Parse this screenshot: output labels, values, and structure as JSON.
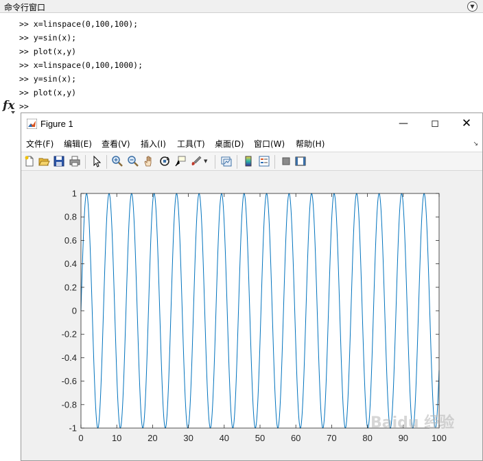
{
  "command_window": {
    "title": "命令行窗口",
    "prompt": ">>",
    "lines": [
      ">> x=linspace(0,100,100);",
      ">> y=sin(x);",
      ">> plot(x,y)",
      ">> x=linspace(0,100,1000);",
      ">> y=sin(x);",
      ">> plot(x,y)"
    ],
    "fx_label": "fx"
  },
  "figure": {
    "title": "Figure 1",
    "menus": [
      "文件(F)",
      "编辑(E)",
      "查看(V)",
      "插入(I)",
      "工具(T)",
      "桌面(D)",
      "窗口(W)",
      "帮助(H)"
    ],
    "toolbar_icons": [
      "new-figure-icon",
      "open-file-icon",
      "save-icon",
      "print-icon",
      "pointer-icon",
      "zoom-in-icon",
      "zoom-out-icon",
      "pan-icon",
      "rotate-3d-icon",
      "data-cursor-icon",
      "brush-icon",
      "link-plot-icon",
      "colorbar-icon",
      "legend-icon",
      "hide-plot-tools-icon",
      "show-plot-tools-icon"
    ]
  },
  "chart_data": {
    "type": "line",
    "function": "y = sin(x)",
    "x_range": [
      0,
      100
    ],
    "samples": 1000,
    "xlim": [
      0,
      100
    ],
    "ylim": [
      -1,
      1
    ],
    "xticks": [
      0,
      10,
      20,
      30,
      40,
      50,
      60,
      70,
      80,
      90,
      100
    ],
    "yticks": [
      1,
      0.8,
      0.6,
      0.4,
      0.2,
      0,
      -0.2,
      -0.4,
      -0.6,
      -0.8,
      -1
    ],
    "ytick_labels": [
      "1",
      "0.8",
      "0.6",
      "0.4",
      "0.2",
      "0",
      "-0.2",
      "-0.4",
      "-0.6",
      "-0.8",
      "-1"
    ],
    "line_color": "#0072bd",
    "grid": false
  },
  "watermark": "Baidu 经验"
}
